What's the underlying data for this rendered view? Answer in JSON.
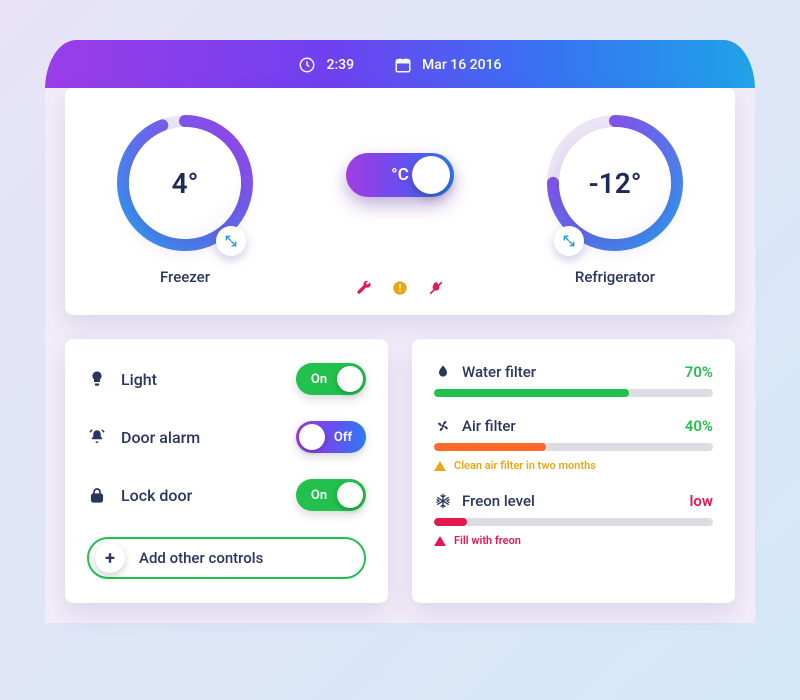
{
  "header": {
    "time": "2:39",
    "date": "Mar 16 2016"
  },
  "unit_toggle": {
    "label": "°C",
    "selected": "C"
  },
  "gauges": {
    "left": {
      "label": "Freezer",
      "value": "4°",
      "arc_pct": 94,
      "color_start": "#2c9df0",
      "color_end": "#9b3ee8"
    },
    "right": {
      "label": "Refrigerator",
      "value": "-12°",
      "arc_pct": 75,
      "color_start": "#9b3ee8",
      "color_end": "#2c9df0"
    }
  },
  "status_icons": [
    "wrench",
    "warning",
    "flame-off"
  ],
  "controls": {
    "items": [
      {
        "icon": "lightbulb-icon",
        "label": "Light",
        "state": "on",
        "state_label": "On"
      },
      {
        "icon": "bell-icon",
        "label": "Door alarm",
        "state": "off",
        "state_label": "Off"
      },
      {
        "icon": "lock-icon",
        "label": "Lock door",
        "state": "on",
        "state_label": "On"
      }
    ],
    "add_label": "Add other controls"
  },
  "metrics": [
    {
      "icon": "droplet-icon",
      "label": "Water filter",
      "value": "70%",
      "value_class": "green",
      "fill_pct": 70,
      "fill_color": "#22c04d",
      "alert": null
    },
    {
      "icon": "fan-icon",
      "label": "Air filter",
      "value": "40%",
      "value_class": "green",
      "fill_pct": 40,
      "fill_color": "#ff6a2b",
      "alert": {
        "level": "orange",
        "text": "Clean air filter in two months"
      }
    },
    {
      "icon": "snowflake-icon",
      "label": "Freon level",
      "value": "low",
      "value_class": "red",
      "fill_pct": 12,
      "fill_color": "#e5184e",
      "alert": {
        "level": "red",
        "text": "Fill with freon"
      }
    }
  ],
  "colors": {
    "navy": "#2a365f",
    "green": "#22c04d",
    "red": "#e5184e",
    "orange": "#ff6a2b"
  }
}
